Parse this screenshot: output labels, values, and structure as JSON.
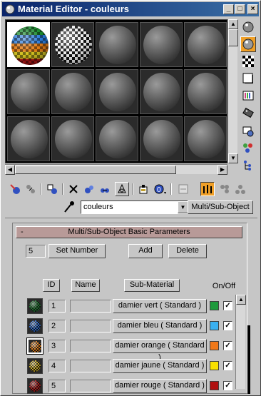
{
  "window": {
    "title": "Material Editor - couleurs",
    "buttons": {
      "minimize": "_",
      "maximize": "□",
      "close": "×"
    }
  },
  "slots": {
    "rows": [
      [
        "color-check",
        "check",
        "gray",
        "gray",
        "gray"
      ],
      [
        "gray",
        "gray",
        "gray",
        "gray",
        "gray"
      ],
      [
        "gray",
        "gray",
        "gray",
        "gray",
        "gray"
      ]
    ],
    "active_index": 0
  },
  "side_tools": [
    {
      "name": "sample-type-icon"
    },
    {
      "name": "backlight-icon",
      "active": true
    },
    {
      "name": "background-checker-icon"
    },
    {
      "name": "sample-uv-tiling-icon"
    },
    {
      "name": "video-color-check-icon"
    },
    {
      "name": "make-preview-icon"
    },
    {
      "name": "options-icon"
    },
    {
      "name": "select-by-material-icon"
    },
    {
      "name": "material-navigator-icon"
    }
  ],
  "name_row": {
    "material_name": "couleurs",
    "material_type": "Multi/Sub-Object"
  },
  "rollout": {
    "title": "Multi/Sub-Object Basic Parameters",
    "collapse": "-",
    "count": "5",
    "set_number": "Set Number",
    "add": "Add",
    "delete": "Delete",
    "headers": {
      "id": "ID",
      "name": "Name",
      "sub_material": "Sub-Material",
      "on_off": "On/Off"
    },
    "rows": [
      {
        "id": "1",
        "name": "",
        "sub": "damier vert  ( Standard )",
        "color": "#1e9a3c",
        "ball": "#1e7a30",
        "on": "✓"
      },
      {
        "id": "2",
        "name": "",
        "sub": "damier bleu  ( Standard )",
        "color": "#3ab0f0",
        "ball": "#2a6ad0",
        "on": "✓"
      },
      {
        "id": "3",
        "name": "",
        "sub": "damier orange  ( Standard )",
        "color": "#f07818",
        "ball": "#e07a14",
        "on": "✓"
      },
      {
        "id": "4",
        "name": "",
        "sub": "damier jaune  ( Standard )",
        "color": "#f8e000",
        "ball": "#d0b020",
        "on": "✓"
      },
      {
        "id": "5",
        "name": "",
        "sub": "damier rouge  ( Standard )",
        "color": "#b01010",
        "ball": "#b81818",
        "on": "✓"
      }
    ]
  }
}
